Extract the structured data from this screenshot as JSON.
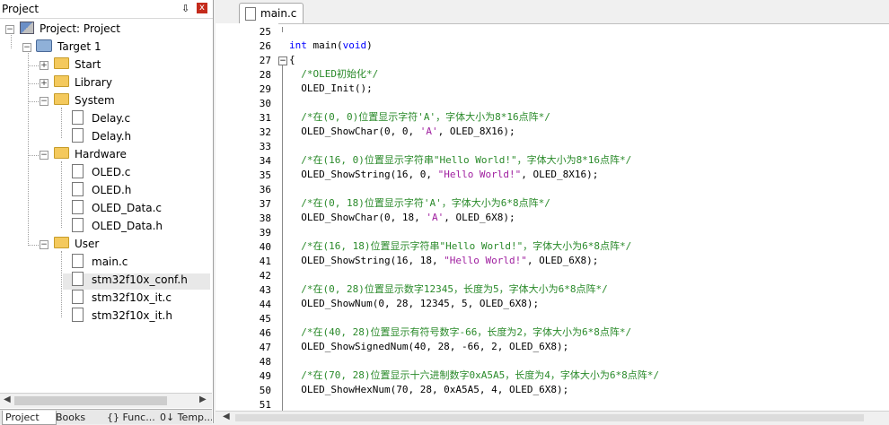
{
  "project_pane": {
    "title": "Project",
    "pin": "⇩",
    "close": "x",
    "tree": [
      {
        "id": "root",
        "label": "Project: Project",
        "icon": "project-icon"
      },
      {
        "id": "target",
        "label": "Target 1",
        "icon": "target-icon"
      },
      {
        "id": "start",
        "label": "Start",
        "icon": "folder-icon",
        "expander": "+"
      },
      {
        "id": "library",
        "label": "Library",
        "icon": "folder-icon",
        "expander": "+"
      },
      {
        "id": "system",
        "label": "System",
        "icon": "folder-icon",
        "expander": "−"
      },
      {
        "id": "delay-c",
        "label": "Delay.c",
        "icon": "file-icon"
      },
      {
        "id": "delay-h",
        "label": "Delay.h",
        "icon": "file-icon"
      },
      {
        "id": "hardware",
        "label": "Hardware",
        "icon": "folder-icon",
        "expander": "−"
      },
      {
        "id": "oled-c",
        "label": "OLED.c",
        "icon": "file-icon"
      },
      {
        "id": "oled-h",
        "label": "OLED.h",
        "icon": "file-icon"
      },
      {
        "id": "oled-data-c",
        "label": "OLED_Data.c",
        "icon": "file-icon"
      },
      {
        "id": "oled-data-h",
        "label": "OLED_Data.h",
        "icon": "file-icon"
      },
      {
        "id": "user",
        "label": "User",
        "icon": "folder-icon",
        "expander": "−"
      },
      {
        "id": "main-c",
        "label": "main.c",
        "icon": "file-icon"
      },
      {
        "id": "conf-h",
        "label": "stm32f10x_conf.h",
        "icon": "file-icon"
      },
      {
        "id": "it-c",
        "label": "stm32f10x_it.c",
        "icon": "file-icon"
      },
      {
        "id": "it-h",
        "label": "stm32f10x_it.h",
        "icon": "file-icon"
      }
    ],
    "bottom_tabs": [
      "Project",
      "Books",
      "{} Func...",
      "0↓ Temp..."
    ]
  },
  "editor": {
    "tab_label": "main.c",
    "lines": [
      {
        "n": "25",
        "parts": [
          {
            "t": "",
            "c": ""
          }
        ]
      },
      {
        "n": "26",
        "parts": [
          {
            "t": "int",
            "c": "kw"
          },
          {
            "t": " main(",
            "c": ""
          },
          {
            "t": "void",
            "c": "kw"
          },
          {
            "t": ")",
            "c": ""
          }
        ]
      },
      {
        "n": "27",
        "parts": [
          {
            "t": "{",
            "c": ""
          }
        ]
      },
      {
        "n": "28",
        "parts": [
          {
            "t": "  /*OLED初始化*/",
            "c": "cmt"
          }
        ]
      },
      {
        "n": "29",
        "parts": [
          {
            "t": "  OLED_Init();",
            "c": ""
          }
        ]
      },
      {
        "n": "30",
        "parts": [
          {
            "t": "",
            "c": ""
          }
        ]
      },
      {
        "n": "31",
        "parts": [
          {
            "t": "  /*在(0, 0)位置显示字符'A'，字体大小为8*16点阵*/",
            "c": "cmt"
          }
        ]
      },
      {
        "n": "32",
        "parts": [
          {
            "t": "  OLED_ShowChar(0, 0, ",
            "c": ""
          },
          {
            "t": "'A'",
            "c": "str"
          },
          {
            "t": ", OLED_8X16);",
            "c": ""
          }
        ]
      },
      {
        "n": "33",
        "parts": [
          {
            "t": "",
            "c": ""
          }
        ]
      },
      {
        "n": "34",
        "parts": [
          {
            "t": "  /*在(16, 0)位置显示字符串\"Hello World!\"，字体大小为8*16点阵*/",
            "c": "cmt"
          }
        ]
      },
      {
        "n": "35",
        "parts": [
          {
            "t": "  OLED_ShowString(16, 0, ",
            "c": ""
          },
          {
            "t": "\"Hello World!\"",
            "c": "str"
          },
          {
            "t": ", OLED_8X16);",
            "c": ""
          }
        ]
      },
      {
        "n": "36",
        "parts": [
          {
            "t": "",
            "c": ""
          }
        ]
      },
      {
        "n": "37",
        "parts": [
          {
            "t": "  /*在(0, 18)位置显示字符'A'，字体大小为6*8点阵*/",
            "c": "cmt"
          }
        ]
      },
      {
        "n": "38",
        "parts": [
          {
            "t": "  OLED_ShowChar(0, 18, ",
            "c": ""
          },
          {
            "t": "'A'",
            "c": "str"
          },
          {
            "t": ", OLED_6X8);",
            "c": ""
          }
        ]
      },
      {
        "n": "39",
        "parts": [
          {
            "t": "",
            "c": ""
          }
        ]
      },
      {
        "n": "40",
        "parts": [
          {
            "t": "  /*在(16, 18)位置显示字符串\"Hello World!\"，字体大小为6*8点阵*/",
            "c": "cmt"
          }
        ]
      },
      {
        "n": "41",
        "parts": [
          {
            "t": "  OLED_ShowString(16, 18, ",
            "c": ""
          },
          {
            "t": "\"Hello World!\"",
            "c": "str"
          },
          {
            "t": ", OLED_6X8);",
            "c": ""
          }
        ]
      },
      {
        "n": "42",
        "parts": [
          {
            "t": "",
            "c": ""
          }
        ]
      },
      {
        "n": "43",
        "parts": [
          {
            "t": "  /*在(0, 28)位置显示数字12345，长度为5，字体大小为6*8点阵*/",
            "c": "cmt"
          }
        ]
      },
      {
        "n": "44",
        "parts": [
          {
            "t": "  OLED_ShowNum(0, 28, 12345, 5, OLED_6X8);",
            "c": ""
          }
        ]
      },
      {
        "n": "45",
        "parts": [
          {
            "t": "",
            "c": ""
          }
        ]
      },
      {
        "n": "46",
        "parts": [
          {
            "t": "  /*在(40, 28)位置显示有符号数字-66，长度为2，字体大小为6*8点阵*/",
            "c": "cmt"
          }
        ]
      },
      {
        "n": "47",
        "parts": [
          {
            "t": "  OLED_ShowSignedNum(40, 28, -66, 2, OLED_6X8);",
            "c": ""
          }
        ]
      },
      {
        "n": "48",
        "parts": [
          {
            "t": "",
            "c": ""
          }
        ]
      },
      {
        "n": "49",
        "parts": [
          {
            "t": "  /*在(70, 28)位置显示十六进制数字0xA5A5，长度为4，字体大小为6*8点阵*/",
            "c": "cmt"
          }
        ]
      },
      {
        "n": "50",
        "parts": [
          {
            "t": "  OLED_ShowHexNum(70, 28, 0xA5A5, 4, OLED_6X8);",
            "c": ""
          }
        ]
      },
      {
        "n": "51",
        "parts": [
          {
            "t": "",
            "c": ""
          }
        ]
      }
    ]
  }
}
